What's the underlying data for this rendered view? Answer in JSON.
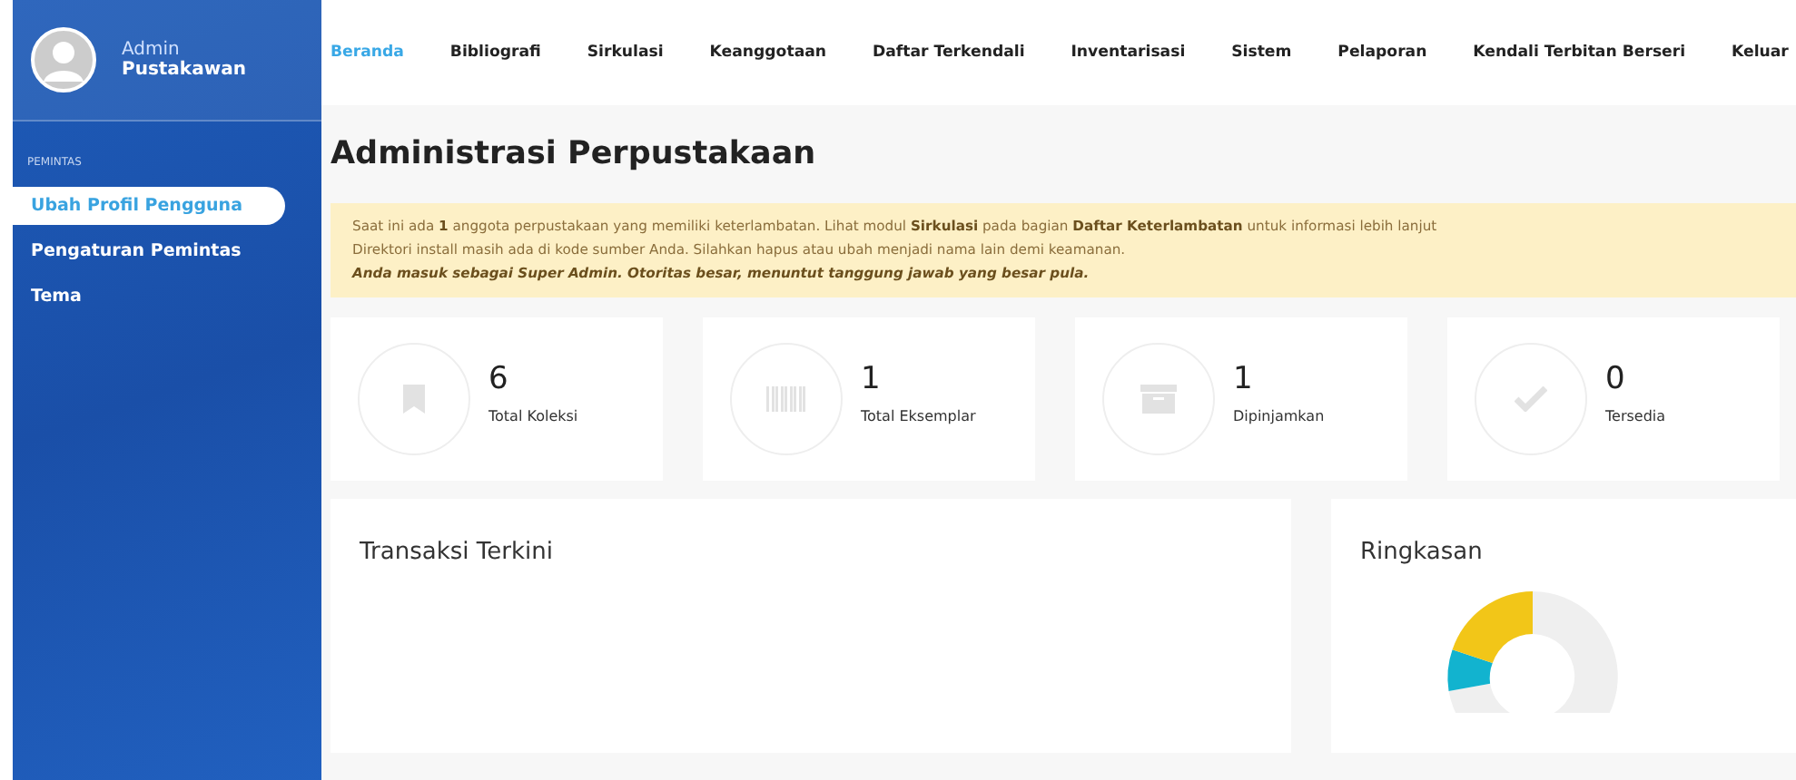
{
  "user": {
    "role": "Admin",
    "name": "Pustakawan"
  },
  "nav": [
    {
      "label": "Beranda",
      "selected": true
    },
    {
      "label": "Bibliografi",
      "selected": false
    },
    {
      "label": "Sirkulasi",
      "selected": false
    },
    {
      "label": "Keanggotaan",
      "selected": false
    },
    {
      "label": "Daftar Terkendali",
      "selected": false
    },
    {
      "label": "Inventarisasi",
      "selected": false
    },
    {
      "label": "Sistem",
      "selected": false
    },
    {
      "label": "Pelaporan",
      "selected": false
    },
    {
      "label": "Kendali Terbitan Berseri",
      "selected": false
    },
    {
      "label": "Keluar",
      "selected": false
    }
  ],
  "sidebar": {
    "section": "PEMINTAS",
    "items": [
      {
        "label": "Ubah Profil Pengguna",
        "selected": true
      },
      {
        "label": "Pengaturan Pemintas",
        "selected": false
      },
      {
        "label": "Tema",
        "selected": false
      }
    ]
  },
  "page_title": "Administrasi Perpustakaan",
  "alert": [
    "Saat ini ada **1** anggota perpustakaan yang memiliki keterlambatan. Lihat modul **Sirkulasi** pada bagian **Daftar Keterlambatan** untuk informasi lebih lanjut",
    "Direktori install masih ada di kode sumber Anda. Silahkan hapus atau ubah menjadi nama lain demi keamanan."
  ],
  "alert_emphasis": "Anda masuk sebagai Super Admin. Otoritas besar, menuntut tanggung jawab yang besar pula.",
  "stats": [
    {
      "kind": "bookmark",
      "value": "6",
      "label": "Total Koleksi"
    },
    {
      "kind": "barcode",
      "value": "1",
      "label": "Total Eksemplar"
    },
    {
      "kind": "archive",
      "value": "1",
      "label": "Dipinjamkan"
    },
    {
      "kind": "check",
      "value": "0",
      "label": "Tersedia"
    }
  ],
  "panels": {
    "transactions": {
      "title": "Transaksi Terkini"
    },
    "summary": {
      "title": "Ringkasan"
    }
  }
}
